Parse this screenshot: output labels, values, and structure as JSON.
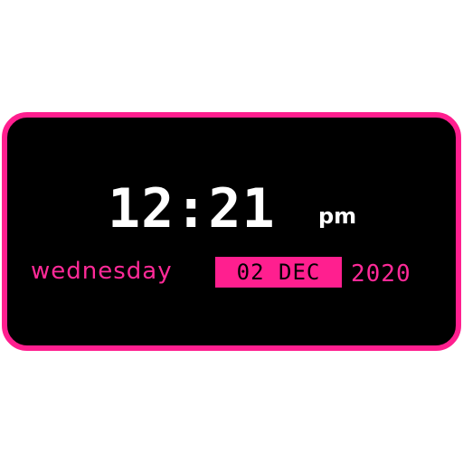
{
  "colors": {
    "accent": "#ff1f8f",
    "background": "#000000",
    "time_text": "#ffffff"
  },
  "clock": {
    "time": "12:21",
    "ampm": "pm"
  },
  "date": {
    "weekday": "wednesday",
    "day_month": "02 DEC",
    "year": "2020"
  }
}
